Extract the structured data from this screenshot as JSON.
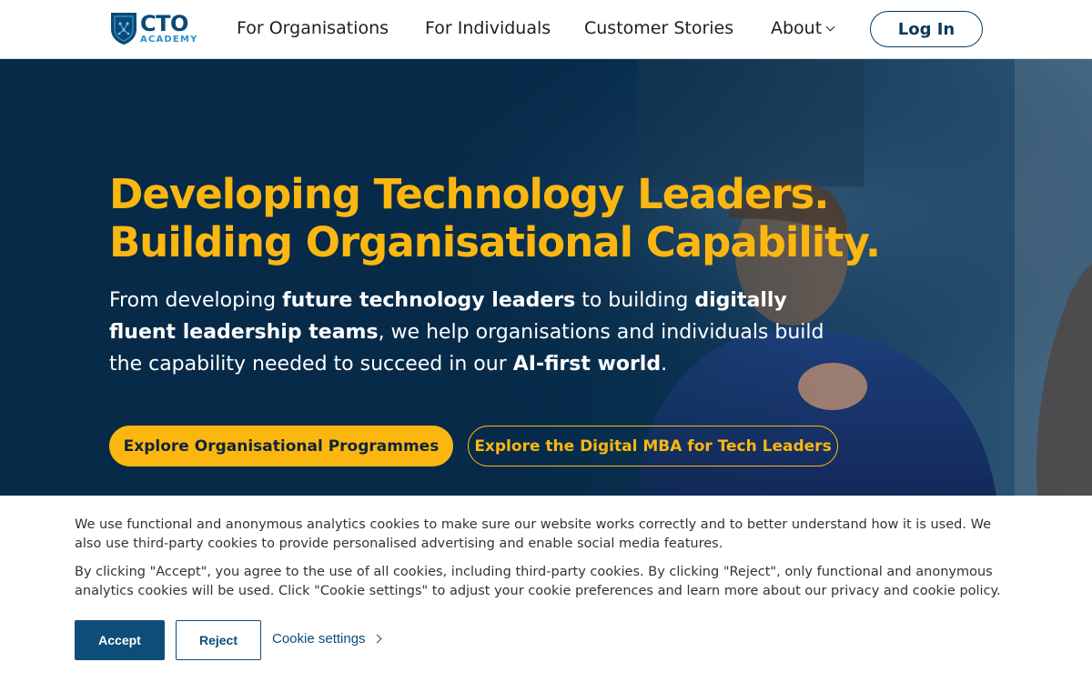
{
  "header": {
    "logo": {
      "line1": "CTO",
      "line2": "ACADEMY",
      "icon": "shield-logo-icon"
    },
    "nav": [
      {
        "label": "For Organisations"
      },
      {
        "label": "For Individuals"
      },
      {
        "label": "Customer Stories"
      },
      {
        "label": "About"
      }
    ],
    "login_label": "Log In"
  },
  "hero": {
    "title_line1": "Developing Technology Leaders.",
    "title_line2": "Building Organisational Capability.",
    "sub": {
      "t1": "From developing ",
      "b1": "future technology leaders",
      "t2": " to building ",
      "b2": "digitally fluent leadership teams",
      "t3": ", we help organisations and individuals build the capability needed to succeed in our ",
      "b3": "AI-first world",
      "t4": "."
    },
    "primary_cta": "Explore Organisational Programmes",
    "secondary_cta": "Explore the Digital MBA for Tech Leaders"
  },
  "cookie_banner": {
    "paragraph1": "We use functional and anonymous analytics cookies to make sure our website works correctly and to better understand how it is used. We also use third-party cookies to provide personalised advertising and enable social media features.",
    "paragraph2": "By clicking \"Accept\", you agree to the use of all cookies, including third-party cookies. By clicking \"Reject\", only functional and anonymous analytics cookies will be used. Click \"Cookie settings\" to adjust your cookie preferences and learn more about our privacy and cookie policy.",
    "accept_label": "Accept",
    "reject_label": "Reject",
    "settings_label": "Cookie settings"
  },
  "colors": {
    "brand_navy": "#0b3a5c",
    "accent_yellow": "#fbb710",
    "hero_bg": "#062a48",
    "button_blue": "#0d4d7a"
  }
}
